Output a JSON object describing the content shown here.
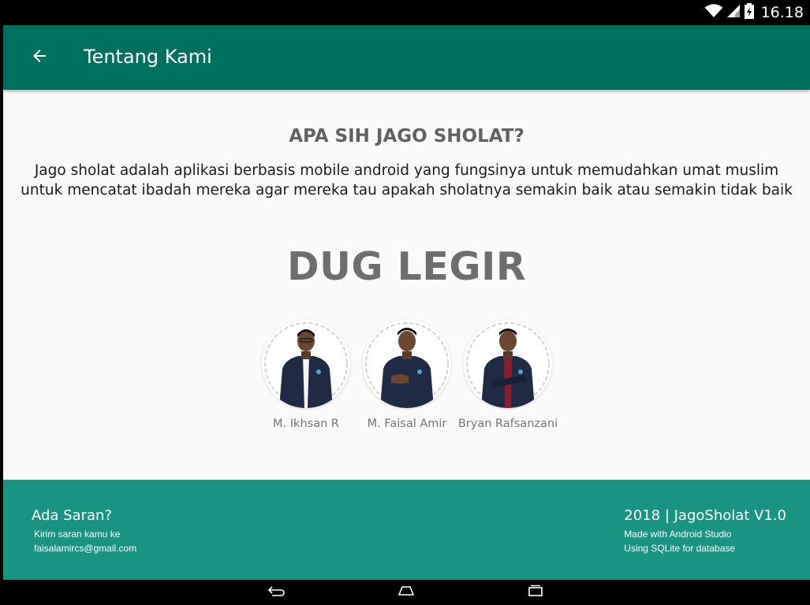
{
  "status_bar": {
    "time": "16.18",
    "icons": [
      "wifi-icon",
      "cell-signal-icon",
      "battery-icon"
    ]
  },
  "app_bar": {
    "title": "Tentang Kami",
    "back_icon": "arrow-left-icon",
    "color": "#00715f"
  },
  "about": {
    "heading": "APA SIH JAGO SHOLAT?",
    "description": "Jago sholat adalah aplikasi berbasis mobile android yang fungsinya untuk memudahkan umat muslim untuk mencatat ibadah mereka agar mereka tau apakah sholatnya semakin baik atau semakin tidak baik"
  },
  "team": {
    "name": "DUG LEGIR",
    "members": [
      {
        "name": "M. Ikhsan R",
        "photo": "member-photo"
      },
      {
        "name": "M. Faisal Amir",
        "photo": "member-photo"
      },
      {
        "name": "Bryan Rafsanzani",
        "photo": "member-photo"
      }
    ]
  },
  "footer": {
    "left": {
      "title": "Ada Saran?",
      "line1": "Kirim saran kamu ke",
      "line2": "faisalamircs@gmail.com"
    },
    "right": {
      "title": "2018 | JagoSholat V1.0",
      "line1": "Made with Android Studio",
      "line2": "Using SQLite for database"
    },
    "color": "#199483"
  },
  "nav_bar": {
    "buttons": [
      "back-nav-icon",
      "home-nav-icon",
      "recents-nav-icon"
    ]
  }
}
